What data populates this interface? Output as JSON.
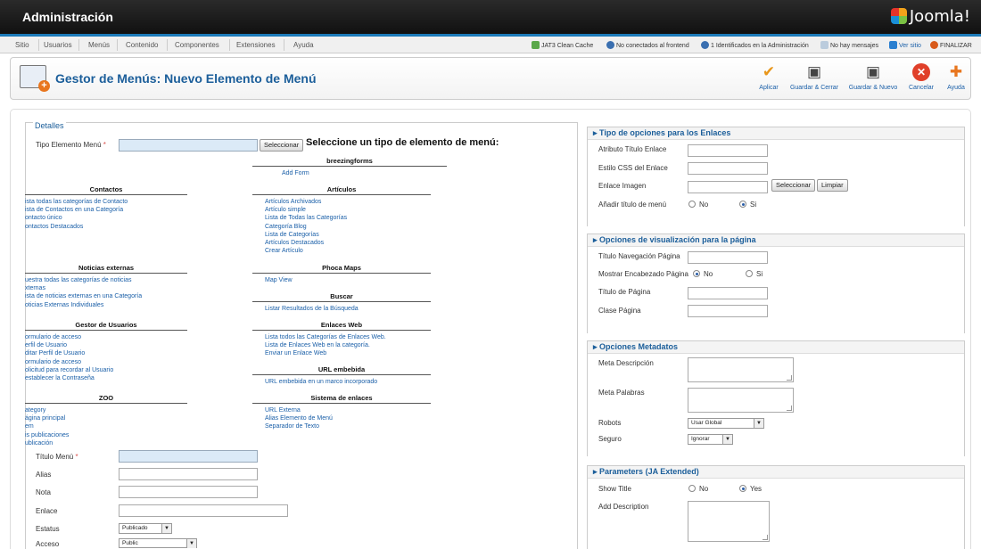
{
  "header": {
    "title": "Administración",
    "logo": "Joomla!"
  },
  "menubar": {
    "items": [
      "Sitio",
      "Usuarios",
      "Menús",
      "Contenido",
      "Componentes",
      "Extensiones",
      "Ayuda"
    ],
    "status": {
      "cache": "JAT3 Clean Cache",
      "frontend": "No conectados al frontend",
      "admin": "1 Identificados en la Administración",
      "messages": "No hay mensajes",
      "view_site": "Ver sitio",
      "logout": "FINALIZAR"
    }
  },
  "toolbar": {
    "title": "Gestor de Menús: Nuevo Elemento de Menú",
    "buttons": {
      "apply": "Aplicar",
      "save_close": "Guardar & Cerrar",
      "save_new": "Guardar & Nuevo",
      "cancel": "Cancelar",
      "help": "Ayuda"
    }
  },
  "details": {
    "legend": "Detalles",
    "type_label": "Tipo Elemento Menú",
    "required_mark": "*",
    "select_button": "Seleccionar",
    "title_label": "Título Menú",
    "alias_label": "Alias",
    "note_label": "Nota",
    "link_label": "Enlace",
    "status_label": "Estatus",
    "status_value": "Publicado",
    "access_label": "Acceso",
    "access_value": "Public"
  },
  "types_popup": {
    "title": "Seleccione un tipo de elemento de menú:",
    "left": [
      {
        "group": "Contactos",
        "links": [
          "ista todas las categorías de Contacto",
          "ista de Contactos en una Categoría",
          "ontacto único",
          "ontactos Destacados"
        ]
      },
      {
        "group": "Noticias externas",
        "links": [
          "uestra todas las categorías de noticias",
          "xternas",
          "ista de noticias externas en una Categoría",
          "oticias Externas Individuales"
        ]
      },
      {
        "group": "Gestor de Usuarios",
        "links": [
          "ormulario de acceso",
          "erfil de Usuario",
          "ditar Perfil de Usuario",
          "ormulario de acceso",
          "olicitud para recordar al Usuario",
          "establecer la Contraseña"
        ]
      },
      {
        "group": "ZOO",
        "links": [
          "ategory",
          "ágina principal",
          "em",
          "is publicaciones",
          "ublicación"
        ]
      }
    ],
    "right": [
      {
        "group": "breezingforms",
        "links": [
          "Add Form"
        ]
      },
      {
        "group": "Artículos",
        "links": [
          "Artículos Archivados",
          "Artículo simple",
          "Lista de Todas las Categorías",
          "Categoría Blog",
          "Lista de Categorías",
          "Artículos Destacados",
          "Crear Artículo"
        ]
      },
      {
        "group": "Phoca Maps",
        "links": [
          "Map View"
        ]
      },
      {
        "group": "Buscar",
        "links": [
          "Listar Resultados de la Búsqueda"
        ]
      },
      {
        "group": "Enlaces Web",
        "links": [
          "Lista todos las Categorías de Enlaces Web.",
          "Lista de Enlaces Web en la categoría.",
          "Enviar un Enlace Web"
        ]
      },
      {
        "group": "URL embebida",
        "links": [
          "URL embebida en un marco incorporado"
        ]
      },
      {
        "group": "Sistema de enlaces",
        "links": [
          "URL Externa",
          "Alias Elemento de Menú",
          "Separador de Texto"
        ]
      }
    ]
  },
  "link_options": {
    "title": "Tipo de opciones para los Enlaces",
    "attr_title": "Atributo Título Enlace",
    "css_class": "Estilo CSS del Enlace",
    "image": "Enlace Imagen",
    "image_select": "Seleccionar",
    "image_clear": "Limpiar",
    "add_title": "Añadir título de menú",
    "no": "No",
    "yes": "Si"
  },
  "page_display": {
    "title": "Opciones de visualización para la página",
    "nav_title": "Título Navegación Página",
    "show_heading": "Mostrar Encabezado Página",
    "no": "No",
    "yes": "Si",
    "page_title": "Título de Página",
    "page_class": "Clase Página"
  },
  "metadata": {
    "title": "Opciones Metadatos",
    "description": "Meta Descripción",
    "keywords": "Meta Palabras",
    "robots": "Robots",
    "robots_value": "Usar Global",
    "secure": "Seguro",
    "secure_value": "Ignorar"
  },
  "parameters": {
    "title": "Parameters (JA Extended)",
    "show_title": "Show Title",
    "no": "No",
    "yes": "Yes",
    "add_description": "Add Description"
  }
}
